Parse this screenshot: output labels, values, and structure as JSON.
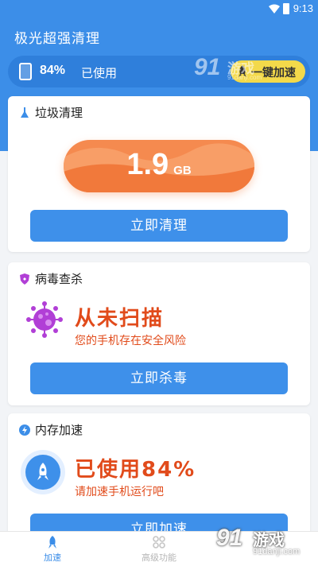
{
  "status_bar": {
    "time": "9:13"
  },
  "app_title": "极光超强清理",
  "usage": {
    "percent": "84%",
    "label": "已使用"
  },
  "boost_button": "一键加速",
  "junk_card": {
    "title": "垃圾清理",
    "size_value": "1.9",
    "size_unit": "GB",
    "button": "立即清理"
  },
  "virus_card": {
    "title": "病毒查杀",
    "headline": "从未扫描",
    "subtext": "您的手机存在安全风险",
    "button": "立即杀毒"
  },
  "memory_card": {
    "title": "内存加速",
    "headline": "已使用84%",
    "subtext": "请加速手机运行吧",
    "button": "立即加速"
  },
  "tabs": [
    {
      "label": "加速",
      "active": true
    },
    {
      "label": "高级功能",
      "active": false
    }
  ],
  "watermark": {
    "logo_number": "91",
    "logo_text": "游戏",
    "site": "91danji.com"
  },
  "colors": {
    "primary_blue": "#3c8ee8",
    "warning_red": "#e14b1b",
    "junk_orange": "#f58a4f",
    "boost_yellow": "#f3d94a",
    "virus_purple": "#b13fd6"
  }
}
